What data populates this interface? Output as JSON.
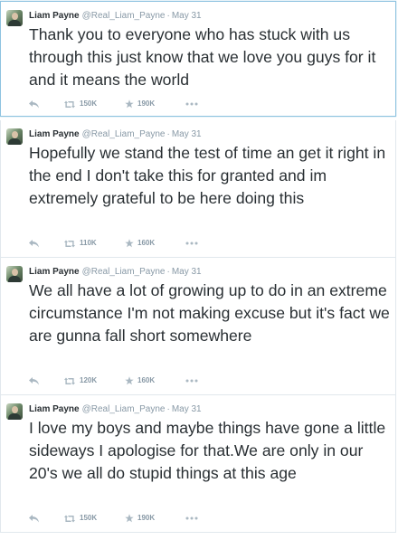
{
  "tweets": [
    {
      "name": "Liam Payne",
      "handle": "@Real_Liam_Payne",
      "dot": "·",
      "date": "May 31",
      "text": "Thank you to everyone who has stuck with us through this just know that we love you guys for it and it means the world",
      "retweets": "150K",
      "favorites": "190K"
    },
    {
      "name": "Liam Payne",
      "handle": "@Real_Liam_Payne",
      "dot": "·",
      "date": "May 31",
      "text": "Hopefully we stand the test of time an get it right in the end I don't take this for granted and im extremely grateful to be here doing this",
      "retweets": "110K",
      "favorites": "160K"
    },
    {
      "name": "Liam Payne",
      "handle": "@Real_Liam_Payne",
      "dot": "·",
      "date": "May 31",
      "text": "We all have a lot of growing up to do in an extreme circumstance I'm not making excuse but it's fact we are gunna fall short somewhere",
      "retweets": "120K",
      "favorites": "160K"
    },
    {
      "name": "Liam Payne",
      "handle": "@Real_Liam_Payne",
      "dot": "·",
      "date": "May 31",
      "text": "I love my boys and maybe things have gone a little sideways I apologise for that.We are only in our 20's we all do stupid things at this age",
      "retweets": "150K",
      "favorites": "190K"
    }
  ],
  "icons": {
    "reply": "reply-icon",
    "retweet": "retweet-icon",
    "favorite": "star-icon",
    "more": "more-icon"
  },
  "colors": {
    "text": "#292f33",
    "meta": "#8899a6",
    "border": "#e1e8ed",
    "focus_border": "#8ec3e0"
  }
}
